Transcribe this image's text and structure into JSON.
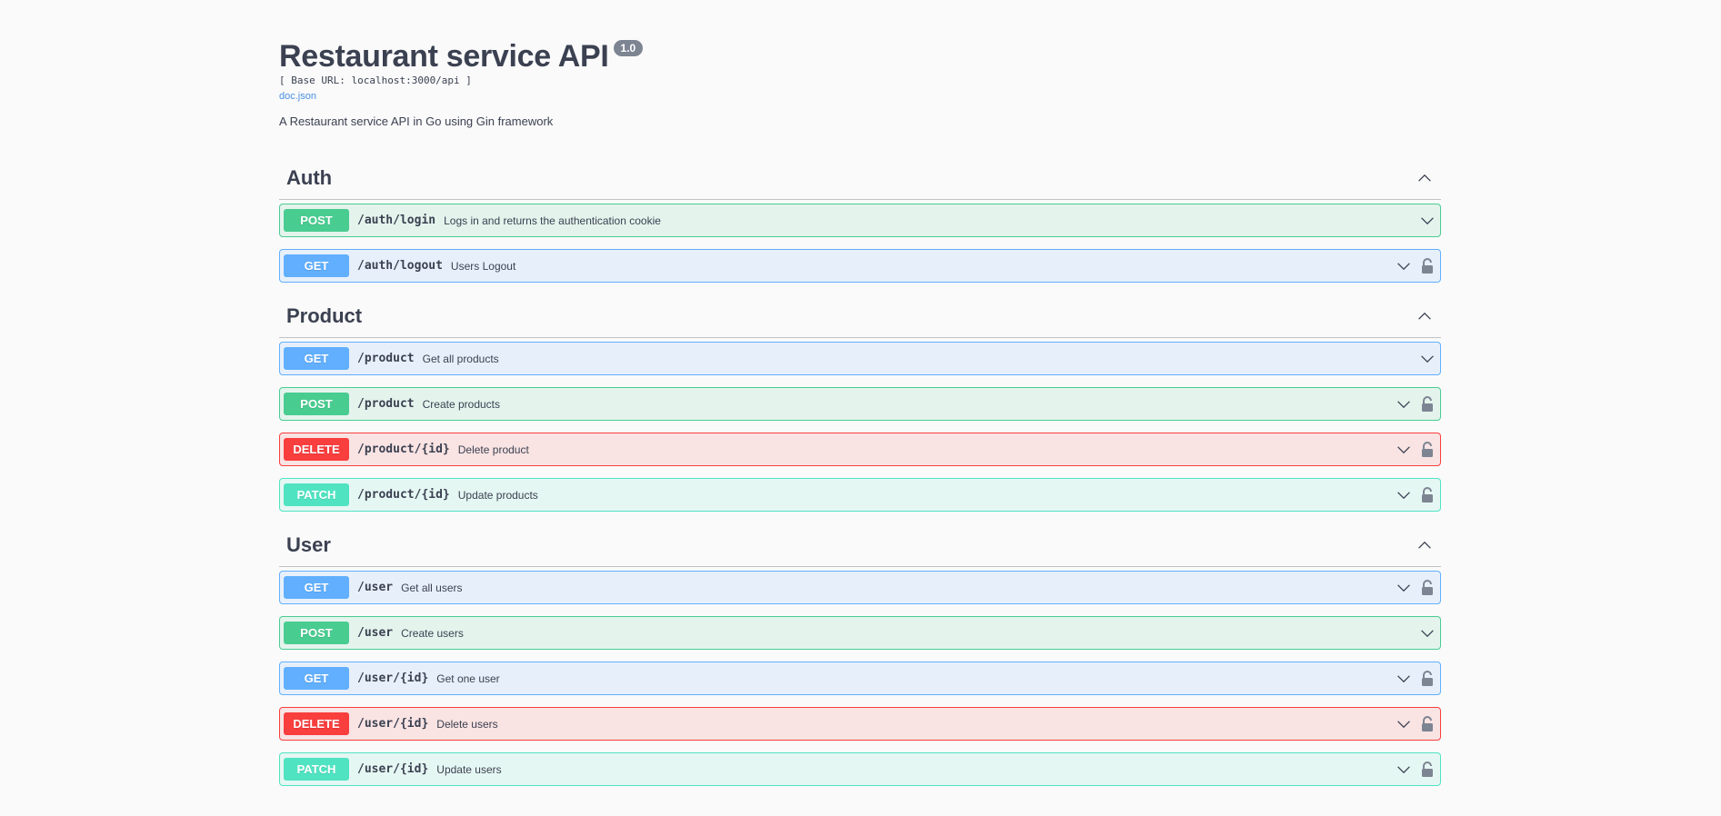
{
  "info": {
    "title": "Restaurant service API",
    "version": "1.0",
    "base_url": "[ Base URL: localhost:3000/api ]",
    "doc_link": "doc.json",
    "description": "A Restaurant service API in Go using Gin framework"
  },
  "icons": {
    "collapse": "chevron-up-icon",
    "expand": "chevron-down-icon",
    "lock": "lock-icon"
  },
  "colors": {
    "post": "#49cc90",
    "get": "#61affe",
    "delete": "#f93e3e",
    "patch": "#50e3c2"
  },
  "tags": [
    {
      "name": "Auth",
      "operations": [
        {
          "method": "POST",
          "path": "/auth/login",
          "summary": "Logs in and returns the authentication cookie",
          "locked": false
        },
        {
          "method": "GET",
          "path": "/auth/logout",
          "summary": "Users Logout",
          "locked": true
        }
      ]
    },
    {
      "name": "Product",
      "operations": [
        {
          "method": "GET",
          "path": "/product",
          "summary": "Get all products",
          "locked": false
        },
        {
          "method": "POST",
          "path": "/product",
          "summary": "Create products",
          "locked": true
        },
        {
          "method": "DELETE",
          "path": "/product/{id}",
          "summary": "Delete product",
          "locked": true
        },
        {
          "method": "PATCH",
          "path": "/product/{id}",
          "summary": "Update products",
          "locked": true
        }
      ]
    },
    {
      "name": "User",
      "operations": [
        {
          "method": "GET",
          "path": "/user",
          "summary": "Get all users",
          "locked": true
        },
        {
          "method": "POST",
          "path": "/user",
          "summary": "Create users",
          "locked": false
        },
        {
          "method": "GET",
          "path": "/user/{id}",
          "summary": "Get one user",
          "locked": true
        },
        {
          "method": "DELETE",
          "path": "/user/{id}",
          "summary": "Delete users",
          "locked": true
        },
        {
          "method": "PATCH",
          "path": "/user/{id}",
          "summary": "Update users",
          "locked": true
        }
      ]
    }
  ]
}
